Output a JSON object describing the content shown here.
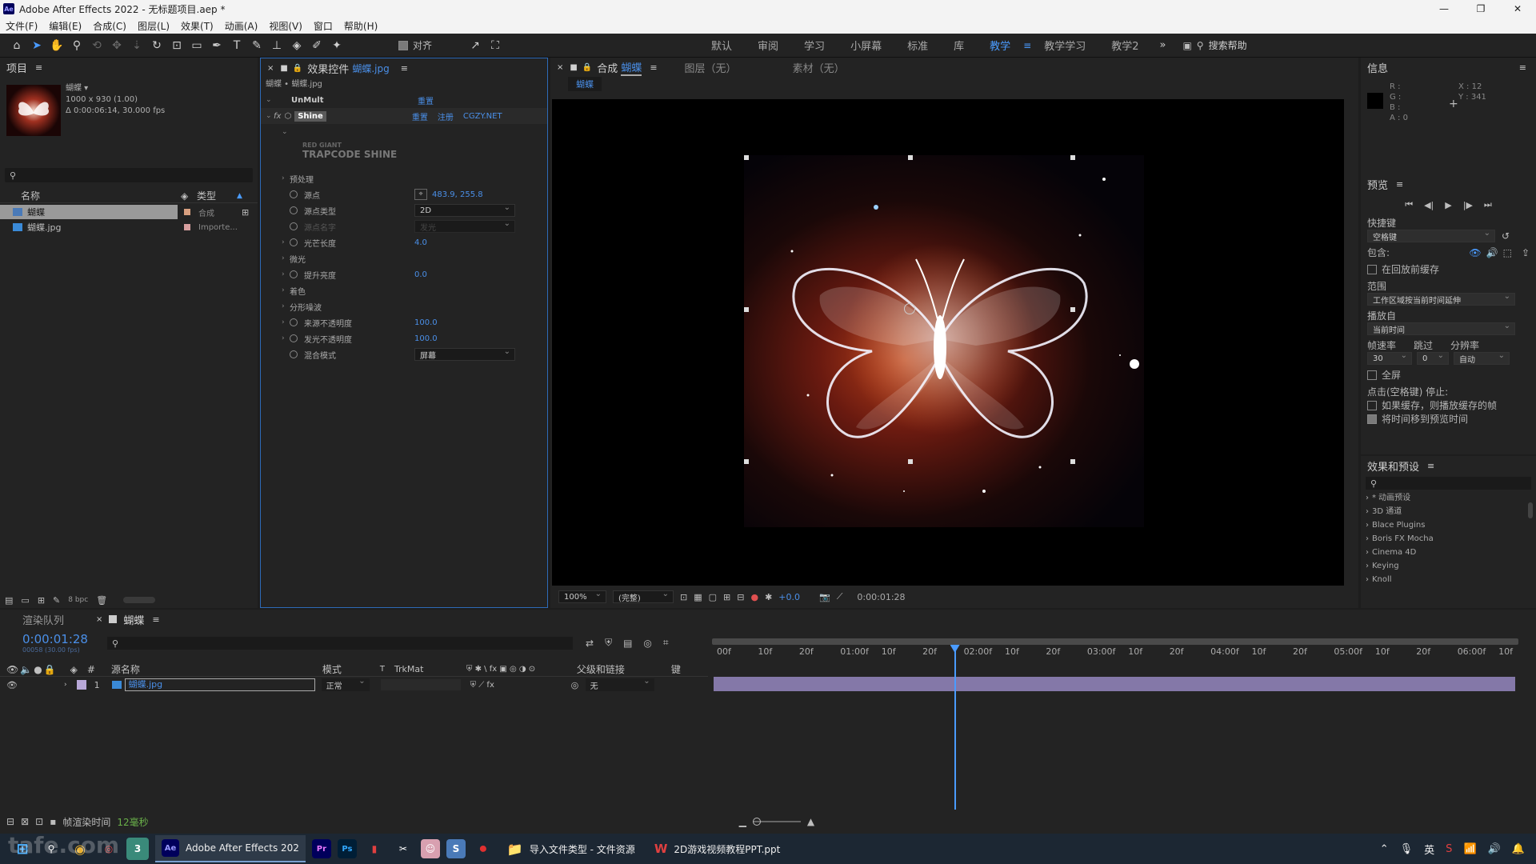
{
  "window": {
    "title": "Adobe After Effects 2022 - 无标题项目.aep *",
    "minimize": "—",
    "maximize": "❐",
    "close": "✕"
  },
  "menu": [
    "文件(F)",
    "编辑(E)",
    "合成(C)",
    "图层(L)",
    "效果(T)",
    "动画(A)",
    "视图(V)",
    "窗口",
    "帮助(H)"
  ],
  "toolbar": {
    "snap_label": "对齐",
    "snap_checked": true
  },
  "workspaces": [
    {
      "label": "默认",
      "active": false
    },
    {
      "label": "审阅",
      "active": false
    },
    {
      "label": "学习",
      "active": false
    },
    {
      "label": "小屏幕",
      "active": false
    },
    {
      "label": "标准",
      "active": false
    },
    {
      "label": "库",
      "active": false
    },
    {
      "label": "教学",
      "active": true
    },
    {
      "label": "教学学习",
      "active": false
    },
    {
      "label": "教学2",
      "active": false
    }
  ],
  "search_help": "搜索帮助",
  "project": {
    "title": "项目",
    "item_name": "蝴蝶 ▾",
    "item_dims": "1000 x 930 (1.00)",
    "item_duration": "Δ 0:00:06:14, 30.000 fps",
    "col_name": "名称",
    "col_type": "类型",
    "items": [
      {
        "name": "蝴蝶",
        "type": "合成",
        "selected": true
      },
      {
        "name": "蝴蝶.jpg",
        "type": "Importe...",
        "selected": false
      }
    ],
    "bpc": "8 bpc"
  },
  "effect_controls": {
    "tab_label": "效果控件",
    "tab_file": "蝴蝶.jpg",
    "breadcrumb": "蝴蝶 • 蝴蝶.jpg",
    "unmult": {
      "name": "UnMult",
      "reset": "重置"
    },
    "shine": {
      "name": "Shine",
      "reset": "重置",
      "register": "注册",
      "site": "CGZY.NET"
    },
    "brand_line1": "RED GIANT",
    "brand_line2": "TRAPCODE SHINE",
    "props": [
      {
        "label": "预处理",
        "value": ""
      },
      {
        "label": "源点",
        "value": "483.9, 255.8"
      },
      {
        "label": "源点类型",
        "value": "2D"
      },
      {
        "label": "源点名字",
        "value": "发光"
      },
      {
        "label": "光芒长度",
        "value": "4.0"
      },
      {
        "label": "微光",
        "value": ""
      },
      {
        "label": "提升亮度",
        "value": "0.0"
      },
      {
        "label": "着色",
        "value": ""
      },
      {
        "label": "分形噪波",
        "value": ""
      },
      {
        "label": "来源不透明度",
        "value": "100.0"
      },
      {
        "label": "发光不透明度",
        "value": "100.0"
      },
      {
        "label": "混合模式",
        "value": "屏幕"
      }
    ]
  },
  "composition": {
    "tab_prefix": "合成",
    "tab_name": "蝴蝶",
    "layer_tab": "图层（无）",
    "footage_tab": "素材（无）",
    "sub_tab": "蝴蝶",
    "zoom": "100%",
    "quality": "(完整)",
    "exposure": "+0.0",
    "timecode": "0:00:01:28"
  },
  "info": {
    "title": "信息",
    "r": "R :",
    "g": "G :",
    "b": "B :",
    "a": "A : 0",
    "x": "X : 12",
    "y": "Y : 341"
  },
  "preview": {
    "title": "预览",
    "shortcut_label": "快捷键",
    "shortcut_value": "空格键",
    "include_label": "包含:",
    "cache_label": "在回放前缓存",
    "range_label": "范围",
    "range_value": "工作区域按当前时间延伸",
    "play_from_label": "播放自",
    "play_from_value": "当前时间",
    "fps_label": "帧速率",
    "skip_label": "跳过",
    "res_label": "分辨率",
    "fps_value": "30",
    "skip_value": "0",
    "res_value": "自动",
    "fullscreen_label": "全屏",
    "stop_label": "点击(空格键) 停止:",
    "opt1": "如果缓存，则播放缓存的帧",
    "opt2": "将时间移到预览时间",
    "opt1_checked": false,
    "opt2_checked": true
  },
  "effects_presets": {
    "title": "效果和预设",
    "items": [
      "* 动画预设",
      "3D 通道",
      "Blace Plugins",
      "Boris FX Mocha",
      "Cinema 4D",
      "Keying",
      "Knoll"
    ]
  },
  "timeline": {
    "render_queue_tab": "渲染队列",
    "comp_tab": "蝴蝶",
    "timecode": "0:00:01:28",
    "frame_info": "00058 (30.00 fps)",
    "col_source": "源名称",
    "col_mode": "模式",
    "col_t": "T",
    "col_trkmat": "TrkMat",
    "col_parent": "父级和链接",
    "col_keys": "键",
    "layer": {
      "index": "1",
      "name": "蝴蝶.jpg",
      "mode": "正常",
      "parent": "无"
    },
    "ruler": [
      "00f",
      "10f",
      "20f",
      "01:00f",
      "10f",
      "20f",
      "02:00f",
      "10f",
      "20f",
      "03:00f",
      "10f",
      "20f",
      "04:00f",
      "10f",
      "20f",
      "05:00f",
      "10f",
      "20f",
      "06:00f",
      "10f"
    ],
    "playhead_fraction": 0.3,
    "render_time_label": "帧渲染时间",
    "render_time_value": "12毫秒"
  },
  "taskbar": {
    "ae_label": "Adobe After Effects 202",
    "explorer_label": "导入文件类型 - 文件资源",
    "ppt_label": "2D游戏视频教程PPT.ppt",
    "ime": "英",
    "watermark": "tafe.com"
  }
}
